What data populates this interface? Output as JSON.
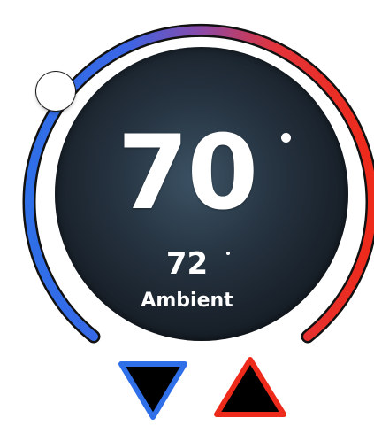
{
  "thermostat": {
    "setpoint": "70",
    "ambient_temp": "72",
    "ambient_label": "Ambient"
  },
  "colors": {
    "cool": "#2f6fe8",
    "heat": "#ee2a1a",
    "face_center": "#3b5264",
    "face_edge": "#0e1319"
  },
  "controls": {
    "decrease_icon": "down-triangle-icon",
    "increase_icon": "up-triangle-icon"
  }
}
